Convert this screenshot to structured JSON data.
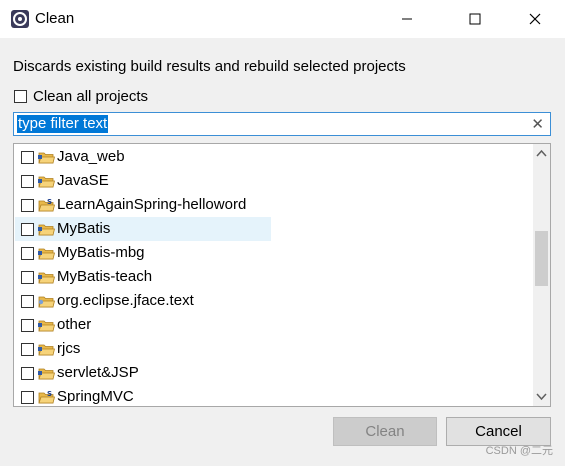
{
  "window": {
    "title": "Clean",
    "controls": [
      "minimize-icon",
      "maximize-icon",
      "close-icon"
    ]
  },
  "description": "Discards existing build results and rebuild selected projects",
  "clean_all": {
    "label": "Clean all projects",
    "checked": false
  },
  "filter": {
    "value": "type filter text",
    "clear_icon": "clear-icon"
  },
  "projects": [
    {
      "label": "Java_web",
      "checked": false,
      "icon": "project-folder-icon"
    },
    {
      "label": "JavaSE",
      "checked": false,
      "icon": "project-folder-icon"
    },
    {
      "label": "LearnAgainSpring-helloword",
      "checked": false,
      "icon": "spring-project-icon"
    },
    {
      "label": "MyBatis",
      "checked": false,
      "icon": "project-folder-icon",
      "highlighted": true
    },
    {
      "label": "MyBatis-mbg",
      "checked": false,
      "icon": "project-folder-icon"
    },
    {
      "label": "MyBatis-teach",
      "checked": false,
      "icon": "project-folder-icon"
    },
    {
      "label": "org.eclipse.jface.text",
      "checked": false,
      "icon": "plugin-project-icon"
    },
    {
      "label": "other",
      "checked": false,
      "icon": "project-folder-icon"
    },
    {
      "label": "rjcs",
      "checked": false,
      "icon": "project-folder-icon"
    },
    {
      "label": "servlet&JSP",
      "checked": false,
      "icon": "project-folder-icon"
    },
    {
      "label": "SpringMVC",
      "checked": false,
      "icon": "spring-project-icon"
    }
  ],
  "buttons": {
    "clean": "Clean",
    "cancel": "Cancel"
  },
  "watermark": "CSDN @二元",
  "colors": {
    "selection": "#0078d7",
    "focus_border": "#3c8fd6",
    "row_highlight": "#e5f3fb"
  }
}
